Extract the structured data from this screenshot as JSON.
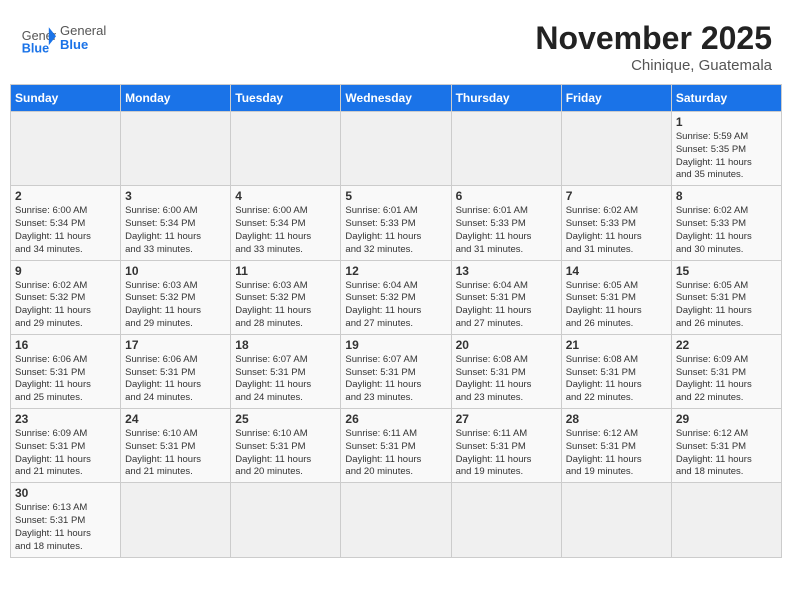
{
  "header": {
    "logo_general": "General",
    "logo_blue": "Blue",
    "month_title": "November 2025",
    "location": "Chinique, Guatemala"
  },
  "days_of_week": [
    "Sunday",
    "Monday",
    "Tuesday",
    "Wednesday",
    "Thursday",
    "Friday",
    "Saturday"
  ],
  "weeks": [
    [
      {
        "day": "",
        "text": ""
      },
      {
        "day": "",
        "text": ""
      },
      {
        "day": "",
        "text": ""
      },
      {
        "day": "",
        "text": ""
      },
      {
        "day": "",
        "text": ""
      },
      {
        "day": "",
        "text": ""
      },
      {
        "day": "1",
        "text": "Sunrise: 5:59 AM\nSunset: 5:35 PM\nDaylight: 11 hours\nand 35 minutes."
      }
    ],
    [
      {
        "day": "2",
        "text": "Sunrise: 6:00 AM\nSunset: 5:34 PM\nDaylight: 11 hours\nand 34 minutes."
      },
      {
        "day": "3",
        "text": "Sunrise: 6:00 AM\nSunset: 5:34 PM\nDaylight: 11 hours\nand 33 minutes."
      },
      {
        "day": "4",
        "text": "Sunrise: 6:00 AM\nSunset: 5:34 PM\nDaylight: 11 hours\nand 33 minutes."
      },
      {
        "day": "5",
        "text": "Sunrise: 6:01 AM\nSunset: 5:33 PM\nDaylight: 11 hours\nand 32 minutes."
      },
      {
        "day": "6",
        "text": "Sunrise: 6:01 AM\nSunset: 5:33 PM\nDaylight: 11 hours\nand 31 minutes."
      },
      {
        "day": "7",
        "text": "Sunrise: 6:02 AM\nSunset: 5:33 PM\nDaylight: 11 hours\nand 31 minutes."
      },
      {
        "day": "8",
        "text": "Sunrise: 6:02 AM\nSunset: 5:33 PM\nDaylight: 11 hours\nand 30 minutes."
      }
    ],
    [
      {
        "day": "9",
        "text": "Sunrise: 6:02 AM\nSunset: 5:32 PM\nDaylight: 11 hours\nand 29 minutes."
      },
      {
        "day": "10",
        "text": "Sunrise: 6:03 AM\nSunset: 5:32 PM\nDaylight: 11 hours\nand 29 minutes."
      },
      {
        "day": "11",
        "text": "Sunrise: 6:03 AM\nSunset: 5:32 PM\nDaylight: 11 hours\nand 28 minutes."
      },
      {
        "day": "12",
        "text": "Sunrise: 6:04 AM\nSunset: 5:32 PM\nDaylight: 11 hours\nand 27 minutes."
      },
      {
        "day": "13",
        "text": "Sunrise: 6:04 AM\nSunset: 5:31 PM\nDaylight: 11 hours\nand 27 minutes."
      },
      {
        "day": "14",
        "text": "Sunrise: 6:05 AM\nSunset: 5:31 PM\nDaylight: 11 hours\nand 26 minutes."
      },
      {
        "day": "15",
        "text": "Sunrise: 6:05 AM\nSunset: 5:31 PM\nDaylight: 11 hours\nand 26 minutes."
      }
    ],
    [
      {
        "day": "16",
        "text": "Sunrise: 6:06 AM\nSunset: 5:31 PM\nDaylight: 11 hours\nand 25 minutes."
      },
      {
        "day": "17",
        "text": "Sunrise: 6:06 AM\nSunset: 5:31 PM\nDaylight: 11 hours\nand 24 minutes."
      },
      {
        "day": "18",
        "text": "Sunrise: 6:07 AM\nSunset: 5:31 PM\nDaylight: 11 hours\nand 24 minutes."
      },
      {
        "day": "19",
        "text": "Sunrise: 6:07 AM\nSunset: 5:31 PM\nDaylight: 11 hours\nand 23 minutes."
      },
      {
        "day": "20",
        "text": "Sunrise: 6:08 AM\nSunset: 5:31 PM\nDaylight: 11 hours\nand 23 minutes."
      },
      {
        "day": "21",
        "text": "Sunrise: 6:08 AM\nSunset: 5:31 PM\nDaylight: 11 hours\nand 22 minutes."
      },
      {
        "day": "22",
        "text": "Sunrise: 6:09 AM\nSunset: 5:31 PM\nDaylight: 11 hours\nand 22 minutes."
      }
    ],
    [
      {
        "day": "23",
        "text": "Sunrise: 6:09 AM\nSunset: 5:31 PM\nDaylight: 11 hours\nand 21 minutes."
      },
      {
        "day": "24",
        "text": "Sunrise: 6:10 AM\nSunset: 5:31 PM\nDaylight: 11 hours\nand 21 minutes."
      },
      {
        "day": "25",
        "text": "Sunrise: 6:10 AM\nSunset: 5:31 PM\nDaylight: 11 hours\nand 20 minutes."
      },
      {
        "day": "26",
        "text": "Sunrise: 6:11 AM\nSunset: 5:31 PM\nDaylight: 11 hours\nand 20 minutes."
      },
      {
        "day": "27",
        "text": "Sunrise: 6:11 AM\nSunset: 5:31 PM\nDaylight: 11 hours\nand 19 minutes."
      },
      {
        "day": "28",
        "text": "Sunrise: 6:12 AM\nSunset: 5:31 PM\nDaylight: 11 hours\nand 19 minutes."
      },
      {
        "day": "29",
        "text": "Sunrise: 6:12 AM\nSunset: 5:31 PM\nDaylight: 11 hours\nand 18 minutes."
      }
    ],
    [
      {
        "day": "30",
        "text": "Sunrise: 6:13 AM\nSunset: 5:31 PM\nDaylight: 11 hours\nand 18 minutes."
      },
      {
        "day": "",
        "text": ""
      },
      {
        "day": "",
        "text": ""
      },
      {
        "day": "",
        "text": ""
      },
      {
        "day": "",
        "text": ""
      },
      {
        "day": "",
        "text": ""
      },
      {
        "day": "",
        "text": ""
      }
    ]
  ]
}
